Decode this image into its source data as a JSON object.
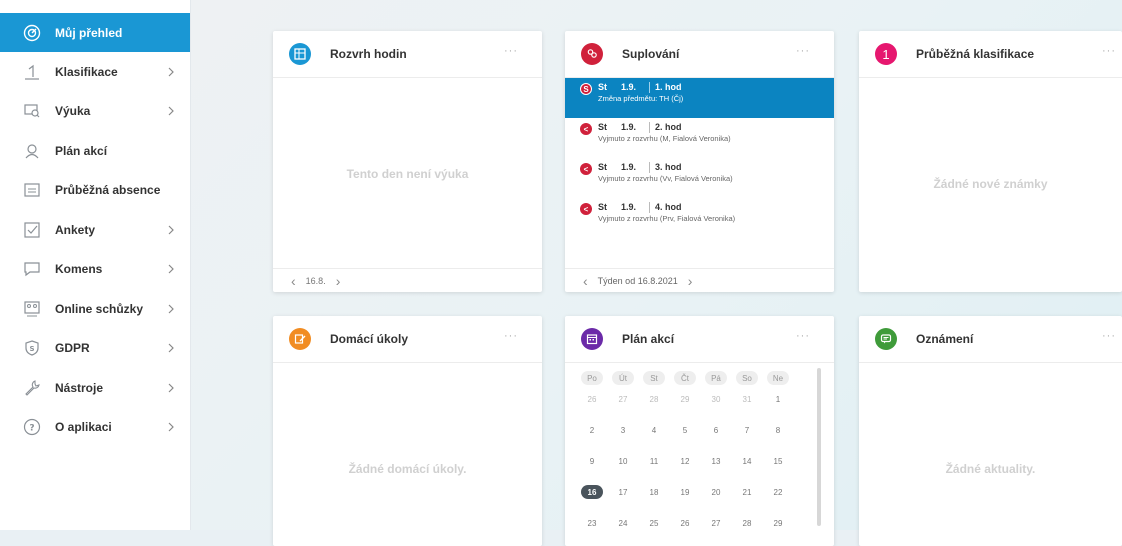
{
  "sidebar": {
    "items": [
      {
        "label": "Můj přehled",
        "icon": "dashboard-icon",
        "chevron": false,
        "active": true
      },
      {
        "label": "Klasifikace",
        "icon": "grade-one-icon",
        "chevron": true,
        "active": false
      },
      {
        "label": "Výuka",
        "icon": "teaching-icon",
        "chevron": true,
        "active": false
      },
      {
        "label": "Plán akcí",
        "icon": "events-plan-icon",
        "chevron": false,
        "active": false
      },
      {
        "label": "Průběžná absence",
        "icon": "absence-icon",
        "chevron": false,
        "active": false
      },
      {
        "label": "Ankety",
        "icon": "survey-checkbox-icon",
        "chevron": true,
        "active": false
      },
      {
        "label": "Komens",
        "icon": "message-icon",
        "chevron": true,
        "active": false
      },
      {
        "label": "Online schůzky",
        "icon": "online-meeting-icon",
        "chevron": true,
        "active": false
      },
      {
        "label": "GDPR",
        "icon": "gdpr-shield-icon",
        "chevron": true,
        "active": false
      },
      {
        "label": "Nástroje",
        "icon": "wrench-icon",
        "chevron": true,
        "active": false
      },
      {
        "label": "O aplikaci",
        "icon": "help-icon",
        "chevron": true,
        "active": false
      }
    ]
  },
  "cards": {
    "rozvrh": {
      "title": "Rozvrh hodin",
      "empty": "Tento den není výuka",
      "footer_date": "16.8.",
      "prev": "‹",
      "next": "›",
      "dots": "···",
      "color": "#1a97d4"
    },
    "suplovani": {
      "title": "Suplování",
      "dots": "···",
      "color": "#d0213b",
      "footer": "Týden od 16.8.2021",
      "prev": "‹",
      "next": "›",
      "items": [
        {
          "badge": "S",
          "day": "St",
          "date": "1.9.",
          "hour": "1. hod",
          "note": "Změna předmětu: TH (Čj)",
          "active": true
        },
        {
          "badge": "<",
          "day": "St",
          "date": "1.9.",
          "hour": "2. hod",
          "note": "Vyjmuto z rozvrhu (M, Fialová Veronika)",
          "active": false
        },
        {
          "badge": "<",
          "day": "St",
          "date": "1.9.",
          "hour": "3. hod",
          "note": "Vyjmuto z rozvrhu (Vv, Fialová Veronika)",
          "active": false
        },
        {
          "badge": "<",
          "day": "St",
          "date": "1.9.",
          "hour": "4. hod",
          "note": "Vyjmuto z rozvrhu (Prv, Fialová Veronika)",
          "active": false
        }
      ]
    },
    "klasifikace": {
      "title": "Průběžná klasifikace",
      "empty": "Žádné nové známky",
      "dots": "···",
      "color": "#e6176f"
    },
    "ukoly": {
      "title": "Domácí úkoly",
      "empty": "Žádné domácí úkoly.",
      "dots": "···",
      "color": "#f18c22"
    },
    "plan": {
      "title": "Plán akcí",
      "dots": "···",
      "color": "#6b2aa8",
      "weekdays": [
        "Po",
        "Út",
        "St",
        "Čt",
        "Pá",
        "So",
        "Ne"
      ],
      "weeks": [
        [
          "26",
          "27",
          "28",
          "29",
          "30",
          "31",
          "1"
        ],
        [
          "2",
          "3",
          "4",
          "5",
          "6",
          "7",
          "8"
        ],
        [
          "9",
          "10",
          "11",
          "12",
          "13",
          "14",
          "15"
        ],
        [
          "16",
          "17",
          "18",
          "19",
          "20",
          "21",
          "22"
        ],
        [
          "23",
          "24",
          "25",
          "26",
          "27",
          "28",
          "29"
        ]
      ],
      "today": "16"
    },
    "oznameni": {
      "title": "Oznámení",
      "empty": "Žádné aktuality.",
      "dots": "···",
      "color": "#3f9b3a"
    }
  }
}
